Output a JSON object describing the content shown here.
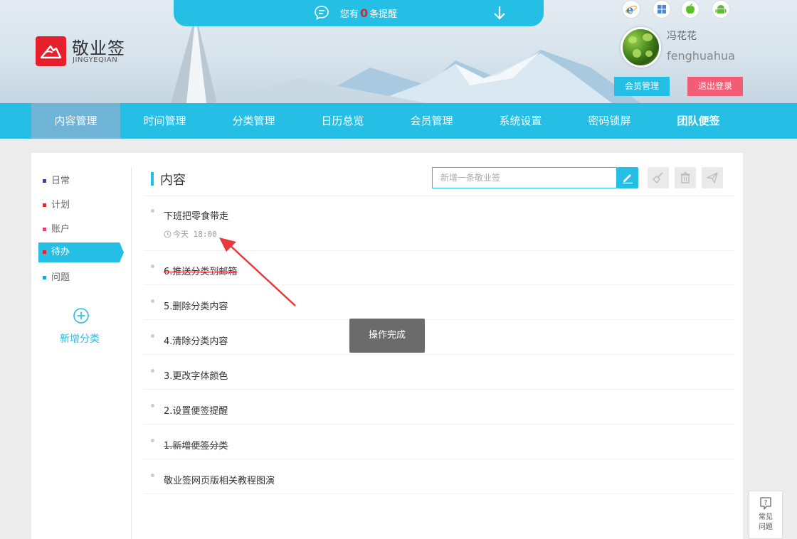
{
  "app": {
    "name": "敬业签",
    "subtitle": "JINGYEQIAN"
  },
  "reminder": {
    "prefix": "您有",
    "count": "0",
    "suffix": "条提醒"
  },
  "platforms": [
    "ie-icon",
    "windows-icon",
    "apple-icon",
    "android-icon"
  ],
  "user": {
    "display_name": "冯花花",
    "username": "fenghuahua"
  },
  "header_buttons": {
    "member": "会员管理",
    "logout": "退出登录"
  },
  "nav": [
    {
      "label": "内容管理",
      "active": true
    },
    {
      "label": "时间管理"
    },
    {
      "label": "分类管理"
    },
    {
      "label": "日历总览"
    },
    {
      "label": "会员管理"
    },
    {
      "label": "系统设置"
    },
    {
      "label": "密码锁屏"
    },
    {
      "label": "团队便签",
      "bold": true
    }
  ],
  "categories": [
    {
      "label": "日常",
      "color": "#4a3f8c"
    },
    {
      "label": "计划",
      "color": "#d9332d"
    },
    {
      "label": "账户",
      "color": "#e0456a"
    },
    {
      "label": "待办",
      "color": "#e5202c",
      "active": true
    },
    {
      "label": "问题",
      "color": "#2a9fd6"
    }
  ],
  "add_category": "新增分类",
  "content": {
    "title": "内容",
    "new_placeholder": "新增一条敬业签"
  },
  "notes": [
    {
      "text": "下班把零食带走",
      "time": "今天 18:00"
    },
    {
      "text": "6.推送分类到邮箱",
      "struck": true
    },
    {
      "text": "5.删除分类内容"
    },
    {
      "text": "4.清除分类内容"
    },
    {
      "text": "3.更改字体颜色"
    },
    {
      "text": "2.设置便签提醒"
    },
    {
      "text": "1.新增便签分类",
      "struck": true
    },
    {
      "text": "敬业签网页版相关教程图演"
    }
  ],
  "toast": "操作完成",
  "faq": {
    "line1": "常见",
    "line2": "问题"
  },
  "colors": {
    "accent": "#25bfe6",
    "brand": "#e5202c",
    "logout": "#f25c74"
  }
}
